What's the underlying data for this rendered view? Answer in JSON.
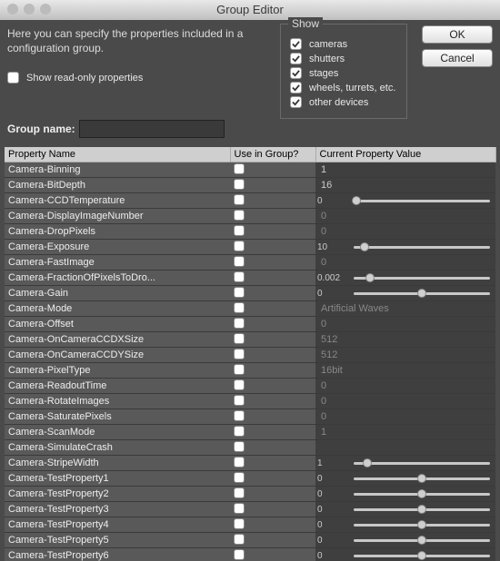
{
  "window_title": "Group Editor",
  "intro_text": "Here you can specify the properties included in a configuration group.",
  "read_only_label": "Show read-only properties",
  "read_only_checked": false,
  "show": {
    "legend": "Show",
    "options": [
      {
        "label": "cameras",
        "checked": true
      },
      {
        "label": "shutters",
        "checked": true
      },
      {
        "label": "stages",
        "checked": true
      },
      {
        "label": "wheels, turrets, etc.",
        "checked": true
      },
      {
        "label": "other devices",
        "checked": true
      }
    ]
  },
  "buttons": {
    "ok": "OK",
    "cancel": "Cancel"
  },
  "group_name": {
    "label": "Group name:",
    "value": ""
  },
  "columns": {
    "c1": "Property Name",
    "c2": "Use in Group?",
    "c3": "Current Property Value"
  },
  "rows": [
    {
      "name": "Camera-Binning",
      "use": false,
      "value": "1",
      "value_color": "#ccc"
    },
    {
      "name": "Camera-BitDepth",
      "use": false,
      "value": "16",
      "value_color": "#ccc"
    },
    {
      "name": "Camera-CCDTemperature",
      "use": false,
      "slider": true,
      "value": "0",
      "thumb": 2
    },
    {
      "name": "Camera-DisplayImageNumber",
      "use": false,
      "value": "0"
    },
    {
      "name": "Camera-DropPixels",
      "use": false,
      "value": "0"
    },
    {
      "name": "Camera-Exposure",
      "use": false,
      "slider": true,
      "value": "10",
      "thumb": 8,
      "value_color": "#ccc"
    },
    {
      "name": "Camera-FastImage",
      "use": false,
      "value": "0"
    },
    {
      "name": "Camera-FractionOfPixelsToDro...",
      "use": false,
      "slider": true,
      "value": "0.002",
      "thumb": 12,
      "value_color": "#ccc"
    },
    {
      "name": "Camera-Gain",
      "use": false,
      "slider": true,
      "value": "0",
      "thumb": 50,
      "value_color": "#ccc"
    },
    {
      "name": "Camera-Mode",
      "use": false,
      "value": "Artificial Waves"
    },
    {
      "name": "Camera-Offset",
      "use": false,
      "value": "0"
    },
    {
      "name": "Camera-OnCameraCCDXSize",
      "use": false,
      "value": "512"
    },
    {
      "name": "Camera-OnCameraCCDYSize",
      "use": false,
      "value": "512"
    },
    {
      "name": "Camera-PixelType",
      "use": false,
      "value": "16bit"
    },
    {
      "name": "Camera-ReadoutTime",
      "use": false,
      "value": "0"
    },
    {
      "name": "Camera-RotateImages",
      "use": false,
      "value": "0"
    },
    {
      "name": "Camera-SaturatePixels",
      "use": false,
      "value": "0"
    },
    {
      "name": "Camera-ScanMode",
      "use": false,
      "value": "1"
    },
    {
      "name": "Camera-SimulateCrash",
      "use": false,
      "value": ""
    },
    {
      "name": "Camera-StripeWidth",
      "use": false,
      "slider": true,
      "value": "1",
      "thumb": 10,
      "value_color": "#ccc"
    },
    {
      "name": "Camera-TestProperty1",
      "use": false,
      "slider": true,
      "value": "0",
      "thumb": 50,
      "value_color": "#ccc"
    },
    {
      "name": "Camera-TestProperty2",
      "use": false,
      "slider": true,
      "value": "0",
      "thumb": 50,
      "value_color": "#ccc"
    },
    {
      "name": "Camera-TestProperty3",
      "use": false,
      "slider": true,
      "value": "0",
      "thumb": 50,
      "value_color": "#ccc"
    },
    {
      "name": "Camera-TestProperty4",
      "use": false,
      "slider": true,
      "value": "0",
      "thumb": 50,
      "value_color": "#ccc"
    },
    {
      "name": "Camera-TestProperty5",
      "use": false,
      "slider": true,
      "value": "0",
      "thumb": 50,
      "value_color": "#ccc"
    },
    {
      "name": "Camera-TestProperty6",
      "use": false,
      "slider": true,
      "value": "0",
      "thumb": 50,
      "value_color": "#ccc"
    }
  ]
}
